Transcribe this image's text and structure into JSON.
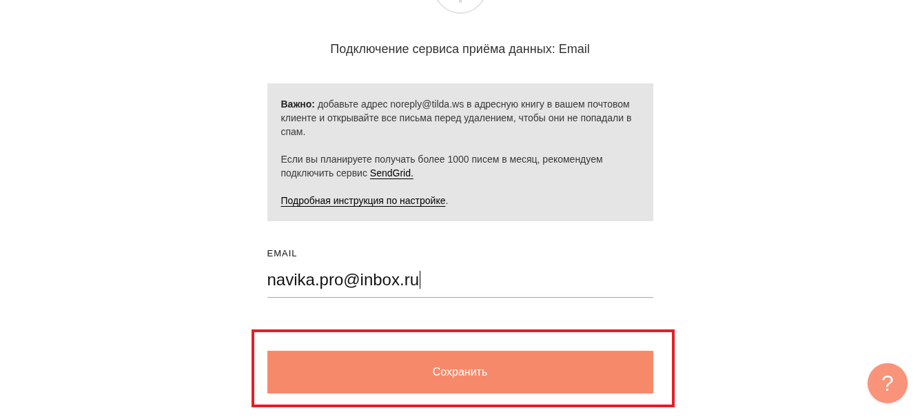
{
  "title": "Подключение сервиса приёма данных: Email",
  "notice": {
    "paragraphs": [
      [
        {
          "kind": "text",
          "text": "**Важно:** добавьте адрес noreply@tilda.ws в адресную книгу в вашем почтовом клиенте и открывайте все письма перед удалением, чтобы они не попадали в спам."
        }
      ],
      [
        {
          "kind": "text",
          "text": "Если вы планируете получать более 1000 писем в месяц, рекомендуем подключить сервис "
        },
        {
          "kind": "link",
          "text": "SendGrid."
        }
      ],
      [
        {
          "kind": "link",
          "text": "Подробная инструкция по настройке"
        },
        {
          "kind": "text",
          "text": "."
        }
      ]
    ]
  },
  "email_field": {
    "label": "EMAIL",
    "value": "navika.pro@inbox.ru",
    "focused": true
  },
  "save_button": {
    "label": "Сохранить",
    "highlighted": true
  },
  "help_button": {
    "label": "?"
  }
}
